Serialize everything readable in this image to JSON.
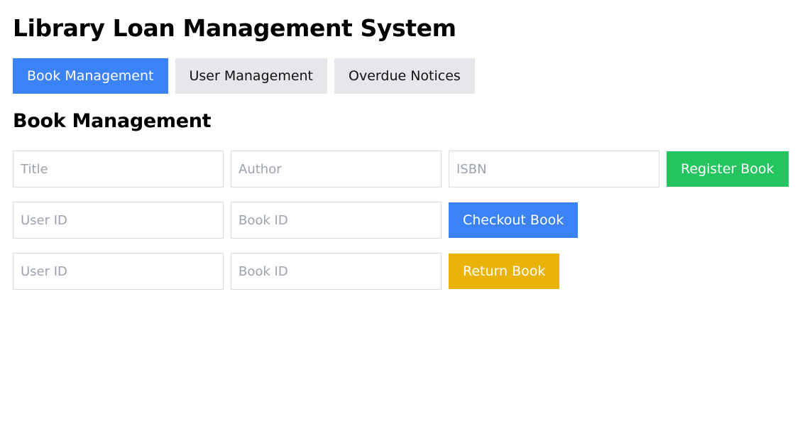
{
  "header": {
    "title": "Library Loan Management System"
  },
  "tabs": [
    {
      "label": "Book Management",
      "active": true
    },
    {
      "label": "User Management",
      "active": false
    },
    {
      "label": "Overdue Notices",
      "active": false
    }
  ],
  "section": {
    "title": "Book Management"
  },
  "register_form": {
    "title_placeholder": "Title",
    "author_placeholder": "Author",
    "isbn_placeholder": "ISBN",
    "title_value": "",
    "author_value": "",
    "isbn_value": "",
    "button_label": "Register Book"
  },
  "checkout_form": {
    "user_id_placeholder": "User ID",
    "book_id_placeholder": "Book ID",
    "user_id_value": "",
    "book_id_value": "",
    "button_label": "Checkout Book"
  },
  "return_form": {
    "user_id_placeholder": "User ID",
    "book_id_placeholder": "Book ID",
    "user_id_value": "",
    "book_id_value": "",
    "button_label": "Return Book"
  },
  "colors": {
    "tab_active": "#3b82f6",
    "tab_inactive": "#e5e7eb",
    "register_button": "#22c55e",
    "checkout_button": "#3b82f6",
    "return_button": "#eab308"
  }
}
